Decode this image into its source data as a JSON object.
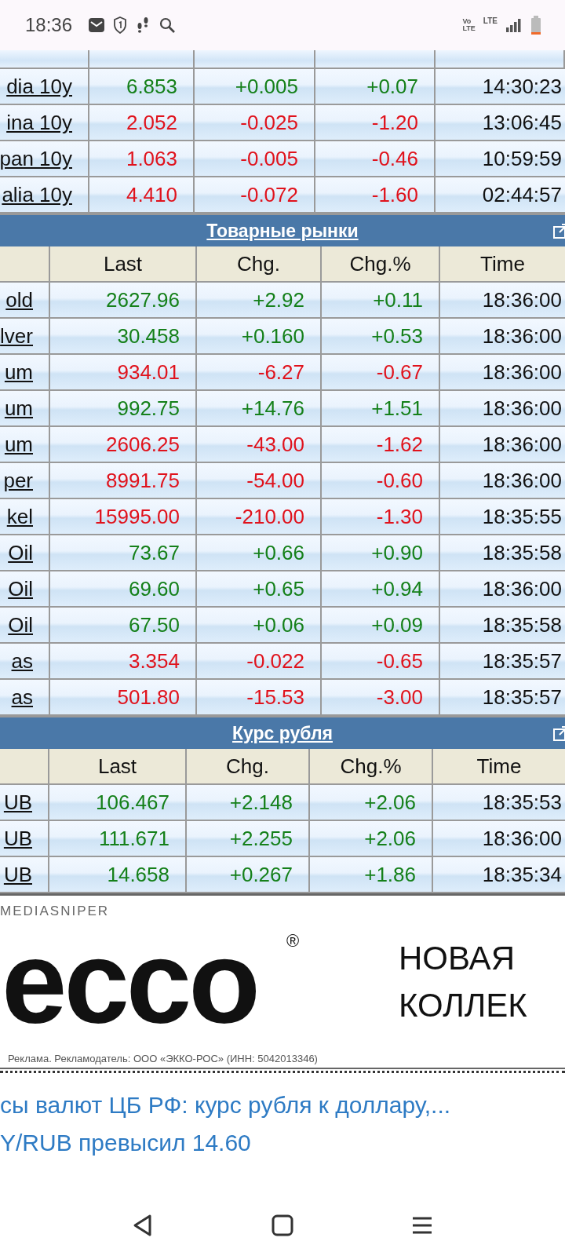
{
  "status_bar": {
    "time": "18:36",
    "volte": [
      "Vo",
      "LTE"
    ],
    "lte": "LTE"
  },
  "tables": [
    {
      "rows": [
        {
          "name": "dia 10y",
          "last": "6.853",
          "chg": "+0.005",
          "chg_pct": "+0.07",
          "time": "14:30:23",
          "rising": true
        },
        {
          "name": "ina 10y",
          "last": "2.052",
          "chg": "-0.025",
          "chg_pct": "-1.20",
          "time": "13:06:45",
          "rising": false
        },
        {
          "name": "pan 10y",
          "last": "1.063",
          "chg": "-0.005",
          "chg_pct": "-0.46",
          "time": "10:59:59",
          "rising": false
        },
        {
          "name": "alia 10y",
          "last": "4.410",
          "chg": "-0.072",
          "chg_pct": "-1.60",
          "time": "02:44:57",
          "rising": false
        }
      ]
    },
    {
      "title": "Товарные рынки",
      "columns": [
        "Last",
        "Chg.",
        "Chg.%",
        "Time"
      ],
      "rows": [
        {
          "name": "old",
          "last": "2627.96",
          "chg": "+2.92",
          "chg_pct": "+0.11",
          "time": "18:36:00",
          "rising": true
        },
        {
          "name": "lver",
          "last": "30.458",
          "chg": "+0.160",
          "chg_pct": "+0.53",
          "time": "18:36:00",
          "rising": true
        },
        {
          "name": "um",
          "last": "934.01",
          "chg": "-6.27",
          "chg_pct": "-0.67",
          "time": "18:36:00",
          "rising": false
        },
        {
          "name": "um",
          "last": "992.75",
          "chg": "+14.76",
          "chg_pct": "+1.51",
          "time": "18:36:00",
          "rising": true
        },
        {
          "name": "um",
          "last": "2606.25",
          "chg": "-43.00",
          "chg_pct": "-1.62",
          "time": "18:36:00",
          "rising": false
        },
        {
          "name": "per",
          "last": "8991.75",
          "chg": "-54.00",
          "chg_pct": "-0.60",
          "time": "18:36:00",
          "rising": false
        },
        {
          "name": "kel",
          "last": "15995.00",
          "chg": "-210.00",
          "chg_pct": "-1.30",
          "time": "18:35:55",
          "rising": false
        },
        {
          "name": "Oil",
          "last": "73.67",
          "chg": "+0.66",
          "chg_pct": "+0.90",
          "time": "18:35:58",
          "rising": true
        },
        {
          "name": "Oil",
          "last": "69.60",
          "chg": "+0.65",
          "chg_pct": "+0.94",
          "time": "18:36:00",
          "rising": true
        },
        {
          "name": "Oil",
          "last": "67.50",
          "chg": "+0.06",
          "chg_pct": "+0.09",
          "time": "18:35:58",
          "rising": true
        },
        {
          "name": "as",
          "last": "3.354",
          "chg": "-0.022",
          "chg_pct": "-0.65",
          "time": "18:35:57",
          "rising": false
        },
        {
          "name": "as",
          "last": "501.80",
          "chg": "-15.53",
          "chg_pct": "-3.00",
          "time": "18:35:57",
          "rising": false
        }
      ]
    },
    {
      "title": "Курс рубля",
      "columns": [
        "Last",
        "Chg.",
        "Chg.%",
        "Time"
      ],
      "rows": [
        {
          "name": "UB",
          "last": "106.467",
          "chg": "+2.148",
          "chg_pct": "+2.06",
          "time": "18:35:53",
          "rising": true
        },
        {
          "name": "UB",
          "last": "111.671",
          "chg": "+2.255",
          "chg_pct": "+2.06",
          "time": "18:36:00",
          "rising": true
        },
        {
          "name": "UB",
          "last": "14.658",
          "chg": "+0.267",
          "chg_pct": "+1.86",
          "time": "18:35:34",
          "rising": true
        }
      ]
    }
  ],
  "ad": {
    "network": "MEDIASNIPER",
    "logo": "ecco",
    "registered": "®",
    "headline": [
      "НОВАЯ",
      "КОЛЛЕК"
    ],
    "disclaimer": "Реклама. Рекламодатель: ООО «ЭККО-РОС» (ИНН: 5042013346)"
  },
  "news": [
    "сы валют ЦБ РФ: курс рубля к доллару,...",
    "Y/RUB превысил 14.60"
  ]
}
